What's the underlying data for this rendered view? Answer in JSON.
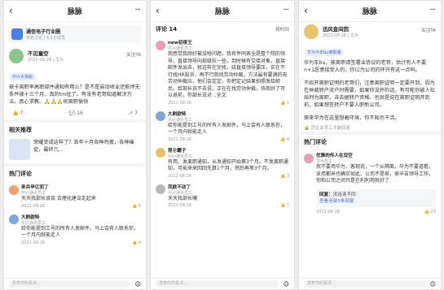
{
  "p1": {
    "title": "脉脉",
    "group_name": "通信电子行业圈",
    "group_sub": "实名讨论 | 4.1万成员",
    "author_name": "不见童空",
    "author_sub": "2021-08-28 | 华为",
    "follow": "关注TA",
    "tag": "中兴大揭秘",
    "body": "被卡离职率高职部件通知有用么？是不是启动收业还能停无条件被十三个月，真的tm扯了。有没有老哥知道解决方法。真心求教。🙏🙏🙏祝离职愉快",
    "likes": "7",
    "comments": "16",
    "shares": "7",
    "rec_title": "相关推荐",
    "rec_text": "荣耀变成这样了？去年十月各种鸡蛋，各种催促，最终几...",
    "hot_title": "热门评论",
    "comments_list": [
      {
        "name": "来兵甲亿而丁",
        "sub": "中兴通讯员工",
        "text": "天天找部长谈谈 合理化建议走起来",
        "time": "2021-08-26",
        "likes": "6"
      },
      {
        "name": "大刷欧特",
        "sub": "中兴通讯员工",
        "text": "给你能提到工号的所有人发邮件，马上会有人联系你，一个月内就能走人",
        "time": "2021-08-26",
        "likes": "4"
      }
    ],
    "input_ph": "发表你的看法..."
  },
  "p2": {
    "title": "脉脉",
    "comments_label": "评论 14",
    "sort_opt": "按时间",
    "author_name": "new初夜王",
    "author_sub": "中兴通讯员工",
    "body": "我感觉我刚好被没啥问题，我有件同表全是整个院的领导，直接领导向部级抗一些，到时候有交接对象，直接邮件发出去，就这样在完找，绕直接领导要压，实在不行找HR投诉，再不行就找劳动仲裁，方法最有要满的去劳动仲裁应，他们会定定，你把定记结果拍照发给邮后，给部长说不去说，正在在找劳动仲裁，协商好了可以退前，你部长说对...全文",
    "body_time": "2021-08-26",
    "likes": "1",
    "list": [
      {
        "name": "大刷欧特",
        "sub": "中兴通讯员工",
        "text": "给你能提到工号的所有人发邮件。马上会有人联系你，一个月内就能走人",
        "time": "2021-08-26",
        "likes": "4"
      },
      {
        "name": "昆仑霸子",
        "sub": "中兴通讯员工",
        "text": "有用。发离职通知，从发通知开始第3个月。不发离职通知，可能来来回回先算1个月，然后再等3个月。",
        "time": "2021-08-26",
        "likes": "3"
      },
      {
        "name": "凤欧不动了",
        "sub": "中兴通讯员工",
        "text": "天天找部长嚷",
        "time": "2021-08-26",
        "likes": "1"
      }
    ],
    "input_ph": "发表你的看法..."
  },
  "p3": {
    "title": "脉脉",
    "author_name": "迅风金间因",
    "author_sub": "2021-08-26 | 华为",
    "follow": "关注TA",
    "tag": "华为今年bu离职潮",
    "body1": "华为车bu，被离职请签署业协议的老哥，估计有人不要n+1愿意接受人的，你以为公司的环只有这一点吗。",
    "body2": "不招开离职证明的老哥们，注意离职证明一定要开到，因为在仲裁转户流户时需要，如果你没开的话，有可能你被人社局判为离职，去去据转户资格。也就是说在离职证明开到前，如果想签转户不要人职新公司。",
    "body3": "原来华为在这里想着环境，你不知也干活。",
    "share_text": "同企业员工才能回复",
    "hot_title": "热门评论",
    "comment": {
      "name": "优雅的传人在双空",
      "sub": "华为员工",
      "text": "我不要用华为，客观说，一个从隔离，华为不要道看，采用都来也确实如此，公司不是家，很辛苦领导工作，你和公司之间只是在利利用就好了"
    },
    "reply_label": "回复：",
    "reply_text": "没连连不同",
    "reply_more": "查看全部5条回复",
    "c_time": "2021-08-26",
    "c_likes": "23",
    "input_ph": "发表你的看法..."
  }
}
